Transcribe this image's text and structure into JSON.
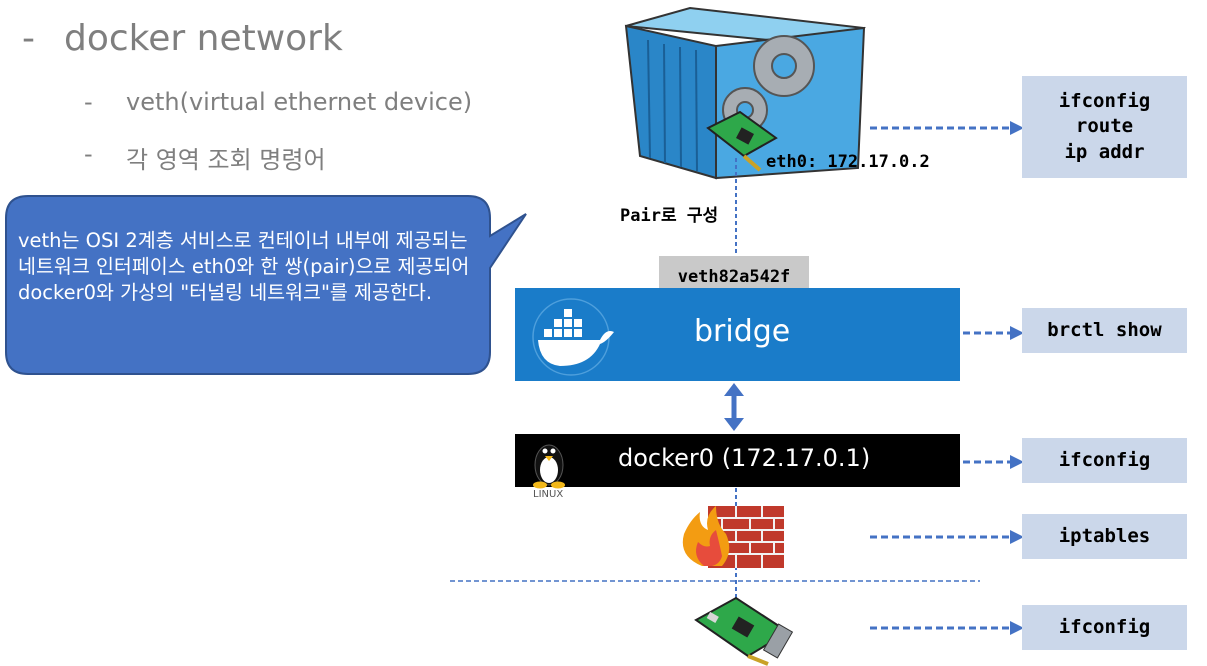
{
  "bullets": {
    "title": "docker network",
    "dash": "-",
    "sub1": "veth(virtual ethernet device)",
    "sub2": "각 영역 조회 명령어"
  },
  "callout": {
    "text": "veth는 OSI 2계층 서비스로 컨테이너 내부에 제공되는 네트워크 인터페이스 eth0와 한 쌍(pair)으로 제공되어 docker0와 가상의 \"터널링 네트워크\"를 제공한다."
  },
  "diagram": {
    "eth0_label": "eth0: 172.17.0.2",
    "pair_label": "Pair로 구성",
    "veth_label": "veth82a542f",
    "bridge_label": "bridge",
    "docker0_label": "docker0 (172.17.0.1)",
    "linux_label": "LINUX"
  },
  "commands": {
    "container": [
      "ifconfig",
      "route",
      "ip addr"
    ],
    "bridge": "brctl show",
    "docker0": "ifconfig",
    "firewall": "iptables",
    "nic": "ifconfig"
  },
  "colors": {
    "bridge_bg": "#1a7cc9",
    "callout_bg": "#4472c4",
    "cmd_bg": "#cbd7ea",
    "arrow": "#4472c4"
  }
}
